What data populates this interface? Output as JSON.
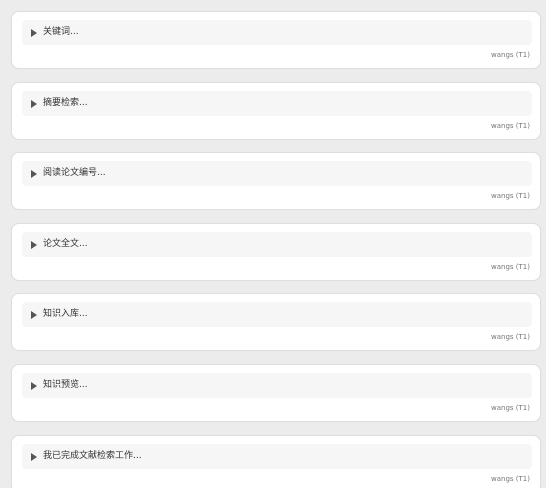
{
  "items": [
    {
      "label": "关键词...",
      "author": "wangs (T1)"
    },
    {
      "label": "摘要检索...",
      "author": "wangs (T1)"
    },
    {
      "label": "阅读论文编号...",
      "author": "wangs (T1)"
    },
    {
      "label": "论文全文...",
      "author": "wangs (T1)"
    },
    {
      "label": "知识入库...",
      "author": "wangs (T1)"
    },
    {
      "label": "知识预览...",
      "author": "wangs (T1)"
    },
    {
      "label": "我已完成文献检索工作...",
      "author": "wangs (T1)"
    }
  ],
  "colors": {
    "background": "#ececec",
    "card": "#ffffff",
    "summary": "#f6f6f6",
    "text": "#333333",
    "muted": "#777777",
    "triangle": "#555555"
  },
  "icons": {
    "disclosure": "caret-right-icon"
  }
}
